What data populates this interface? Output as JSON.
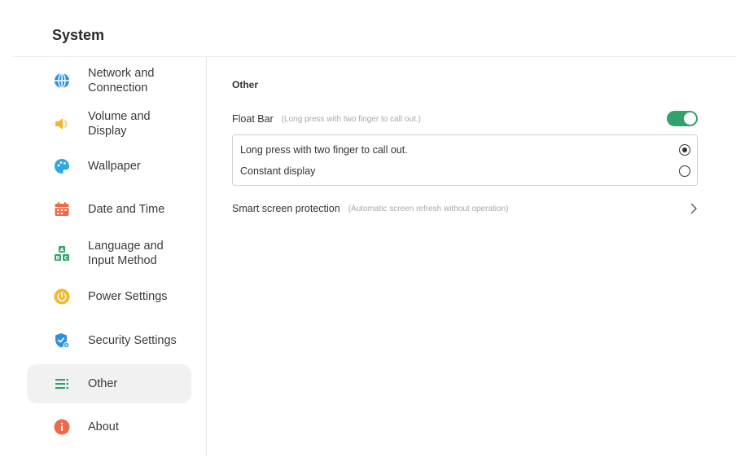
{
  "header": {
    "title": "System"
  },
  "sidebar": {
    "items": [
      {
        "id": "network",
        "label": "Network and Connection",
        "icon": "globe-icon",
        "color": "#2f8fe0",
        "active": false
      },
      {
        "id": "volume",
        "label": "Volume and Display",
        "icon": "speaker-icon",
        "color": "#f2b531",
        "active": false
      },
      {
        "id": "wallpaper",
        "label": "Wallpaper",
        "icon": "palette-icon",
        "color": "#2ea7e5",
        "active": false
      },
      {
        "id": "datetime",
        "label": "Date and Time",
        "icon": "calendar-icon",
        "color": "#ee6a44",
        "active": false
      },
      {
        "id": "language",
        "label": "Language and Input Method",
        "icon": "keyboard-abc-icon",
        "color": "#2fa36b",
        "active": false
      },
      {
        "id": "power",
        "label": "Power Settings",
        "icon": "power-icon",
        "color": "#f5b82b",
        "active": false
      },
      {
        "id": "security",
        "label": "Security Settings",
        "icon": "shield-icon",
        "color": "#2e8fe0",
        "active": false
      },
      {
        "id": "other",
        "label": "Other",
        "icon": "list-icon",
        "color": "#2fa36b",
        "active": true
      },
      {
        "id": "about",
        "label": "About",
        "icon": "info-icon",
        "color": "#ee6a44",
        "active": false
      }
    ]
  },
  "main": {
    "section_title": "Other",
    "float_bar": {
      "label": "Float Bar",
      "hint": "(Long press with two finger to call out.)",
      "enabled": true,
      "accent": "#2fa36b",
      "options": [
        {
          "label": "Long press with two finger to call out.",
          "selected": true
        },
        {
          "label": "Constant display",
          "selected": false
        }
      ]
    },
    "smart_protection": {
      "label": "Smart screen protection",
      "hint": "(Automatic screen refresh without operation)"
    }
  }
}
